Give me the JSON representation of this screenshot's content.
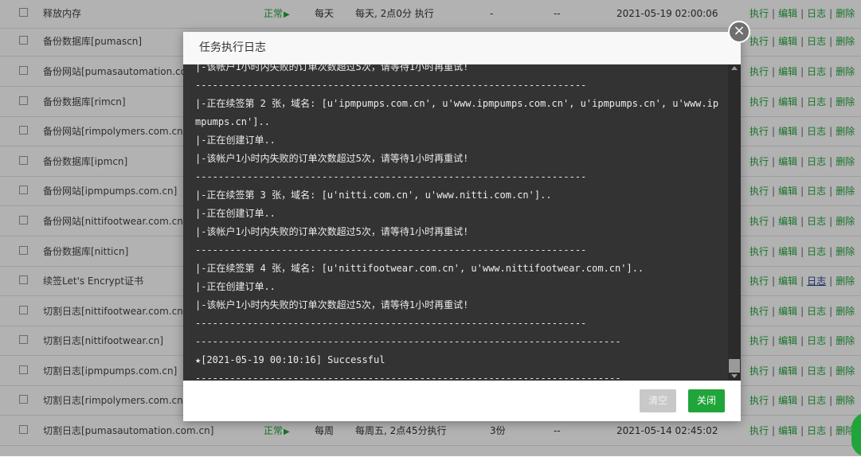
{
  "tasks": [
    {
      "name": "释放内存",
      "status": "正常",
      "status_icon": "play-triangle",
      "period": "每天",
      "cycle": "每天, 2点0分 执行",
      "backup": "-",
      "dest": "--",
      "time": "2021-05-19 02:00:06"
    },
    {
      "name": "备份数据库[pumascn]"
    },
    {
      "name": "备份网站[pumasautomation.com.cn]"
    },
    {
      "name": "备份数据库[rimcn]"
    },
    {
      "name": "备份网站[rimpolymers.com.cn]"
    },
    {
      "name": "备份数据库[ipmcn]"
    },
    {
      "name": "备份网站[ipmpumps.com.cn]"
    },
    {
      "name": "备份网站[nittifootwear.com.cn]"
    },
    {
      "name": "备份数据库[nitticn]"
    },
    {
      "name": "续签Let's Encrypt证书"
    },
    {
      "name": "切割日志[nittifootwear.com.cn]"
    },
    {
      "name": "切割日志[nittifootwear.cn]"
    },
    {
      "name": "切割日志[ipmpumps.com.cn]"
    },
    {
      "name": "切割日志[rimpolymers.com.cn]"
    },
    {
      "name": "切割日志[pumasautomation.com.cn]",
      "status": "正常",
      "status_icon": "play-triangle",
      "period": "每周",
      "cycle": "每周五, 2点45分执行",
      "backup": "3份",
      "dest": "--",
      "time": "2021-05-14 02:45:02"
    }
  ],
  "ops": {
    "execute": "执行",
    "edit": "编辑",
    "log": "日志",
    "delete": "删除",
    "separator": "|"
  },
  "modal": {
    "title": "任务执行日志",
    "close_glyph": "×",
    "clear_label": "清空",
    "close_label": "关闭",
    "log_lines": [
      "|-该帐户1小时内失败的订单次数超过5次，请等待1小时再重试!",
      "--------------------------------------------------------------------",
      "|-正在续签第 2 张，域名: [u'ipmpumps.com.cn', u'www.ipmpumps.com.cn', u'ipmpumps.cn', u'www.ip",
      "mpumps.cn']..",
      "|-正在创建订单..",
      "|-该帐户1小时内失败的订单次数超过5次，请等待1小时再重试!",
      "--------------------------------------------------------------------",
      "|-正在续签第 3 张，域名: [u'nitti.com.cn', u'www.nitti.com.cn']..",
      "|-正在创建订单..",
      "|-该帐户1小时内失败的订单次数超过5次，请等待1小时再重试!",
      "--------------------------------------------------------------------",
      "|-正在续签第 4 张，域名: [u'nittifootwear.com.cn', u'www.nittifootwear.com.cn']..",
      "|-正在创建订单..",
      "|-该帐户1小时内失败的订单次数超过5次，请等待1小时再重试!",
      "--------------------------------------------------------------------",
      "--------------------------------------------------------------------------",
      "★[2021-05-19 00:10:16] Successful",
      "--------------------------------------------------------------------------"
    ]
  },
  "colors": {
    "accent": "#20a53a",
    "log_bg": "#333333",
    "log_text": "#ececec",
    "link_visited": "#1f3f8f"
  }
}
